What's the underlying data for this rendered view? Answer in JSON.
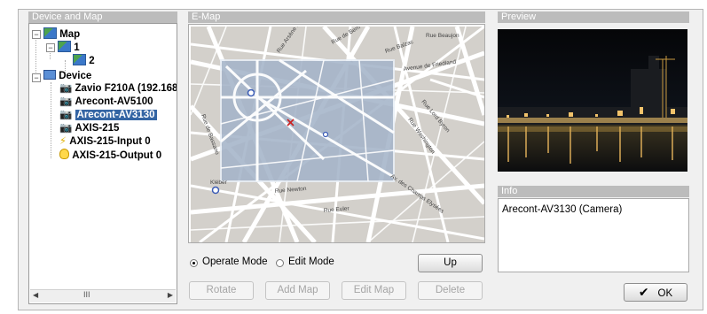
{
  "panels": {
    "device_and_map": "Device and Map",
    "emap": "E-Map",
    "preview": "Preview",
    "info": "Info"
  },
  "tree": {
    "map": "Map",
    "map_1": "1",
    "map_2": "2",
    "device": "Device",
    "devices": [
      "Zavio F210A (192.168.2",
      "Arecont-AV5100",
      "Arecont-AV3130",
      "AXIS-215",
      "AXIS-215-Input 0",
      "AXIS-215-Output 0"
    ],
    "scroll_mid": "III"
  },
  "map": {
    "streets": [
      "Rue de Berri",
      "Rue Balzac",
      "Rue Beaujon",
      "Avenue de Friedland",
      "Rue Washington",
      "Rue Lord Byron",
      "Rue de Bassano",
      "Rue Newton",
      "Rue Euler",
      "Av. des Champs Elysées",
      "Rue Arsène Houssaye"
    ],
    "metro_label": "Kléber"
  },
  "controls": {
    "operate_mode": "Operate Mode",
    "edit_mode": "Edit Mode",
    "mode_selected": "operate",
    "up": "Up",
    "rotate": "Rotate",
    "add_map": "Add Map",
    "edit_map": "Edit Map",
    "delete": "Delete",
    "ok": "OK"
  },
  "info": {
    "text": "Arecont-AV3130 (Camera)"
  }
}
